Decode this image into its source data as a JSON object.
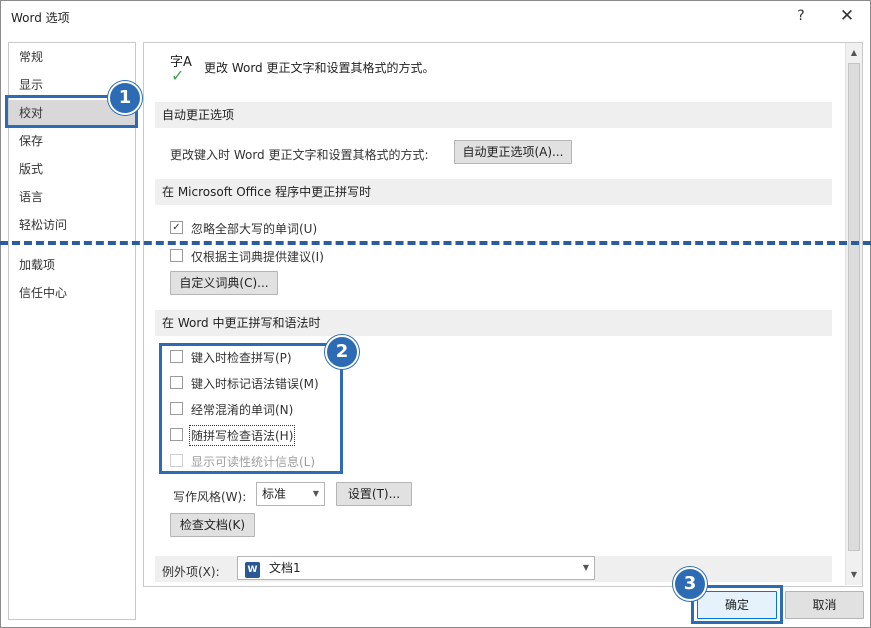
{
  "window": {
    "title": "Word 选项",
    "help": "?",
    "close": "✕"
  },
  "nav": {
    "items": [
      "常规",
      "显示",
      "校对",
      "保存",
      "版式",
      "语言",
      "轻松访问",
      "加载项",
      "信任中心"
    ],
    "active_index": 2
  },
  "proofing": {
    "hero_icon": "字A",
    "hero_check": "✓",
    "hero_text": "更改 Word 更正文字和设置其格式的方式。",
    "autocorrect": {
      "section_title": "自动更正选项",
      "label": "更改键入时 Word 更正文字和设置其格式的方式:",
      "button": "自动更正选项(A)..."
    },
    "office": {
      "section_title": "在 Microsoft Office 程序中更正拼写时",
      "options": [
        {
          "label": "忽略全部大写的单词(U)",
          "checked": true
        },
        {
          "label": "仅根据主词典提供建议(I)",
          "checked": false
        }
      ],
      "custom_dict_button": "自定义词典(C)..."
    },
    "word": {
      "section_title": "在 Word 中更正拼写和语法时",
      "options": [
        {
          "label": "键入时检查拼写(P)",
          "checked": false,
          "disabled": false
        },
        {
          "label": "键入时标记语法错误(M)",
          "checked": false,
          "disabled": false
        },
        {
          "label": "经常混淆的单词(N)",
          "checked": false,
          "disabled": false
        },
        {
          "label": "随拼写检查语法(H)",
          "checked": false,
          "disabled": false
        },
        {
          "label": "显示可读性统计信息(L)",
          "checked": false,
          "disabled": true
        }
      ],
      "style_label": "写作风格(W):",
      "style_value": "标准",
      "settings_button": "设置(T)...",
      "check_doc_button": "检查文档(K)"
    },
    "exceptions": {
      "label": "例外项(X):",
      "doc_icon": "W",
      "value": "文档1"
    }
  },
  "footer": {
    "ok": "确定",
    "cancel": "取消"
  },
  "annotations": {
    "callouts": [
      "1",
      "2",
      "3"
    ],
    "accent_color": "#2d6cb5"
  },
  "icons": {
    "dropdown_arrow": "▼",
    "scroll_up": "▲",
    "scroll_down": "▼"
  }
}
